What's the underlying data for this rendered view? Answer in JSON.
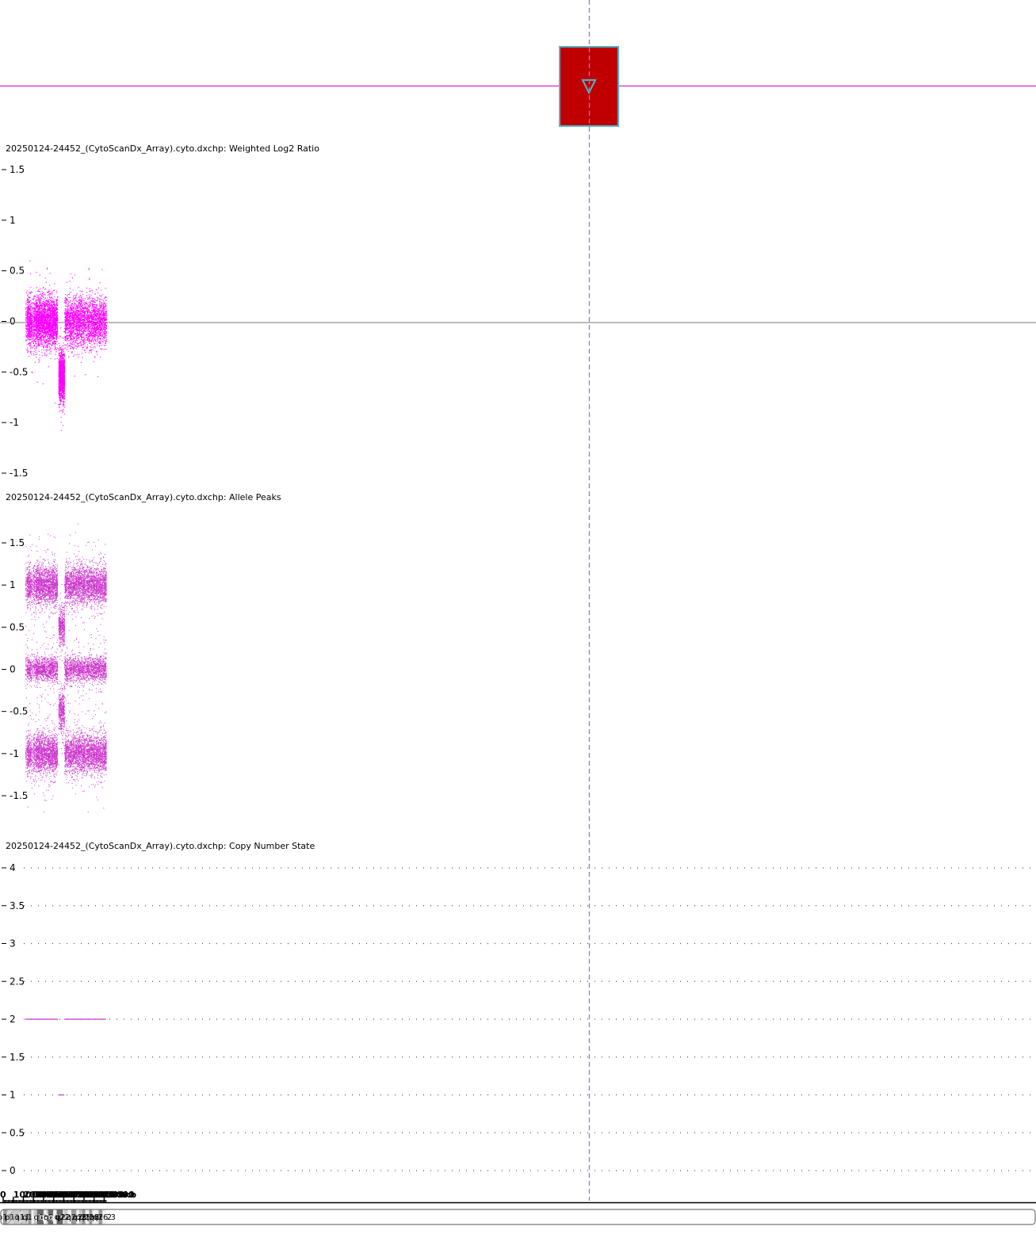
{
  "colors": {
    "signal": "#ff00ff",
    "allele": "#cc33cc",
    "segment_box": "#c00000",
    "segment_border": "#4fb3c8",
    "cursor": "#8080e0"
  },
  "segment_marker": {
    "icon": "triangle-down-icon"
  },
  "tracks": {
    "log2": {
      "title": "20250124-24452_(CytoScanDx_Array).cyto.dxchp: Weighted Log2 Ratio"
    },
    "allele": {
      "title": "20250124-24452_(CytoScanDx_Array).cyto.dxchp: Allele Peaks"
    },
    "cn": {
      "title": "20250124-24452_(CytoScanDx_Array).cyto.dxchp: Copy Number State"
    }
  },
  "chart_data": [
    {
      "type": "scatter",
      "title": "20250124-24452_(CytoScanDx_Array).cyto.dxchp: Weighted Log2 Ratio",
      "ylim": [
        -1.5,
        1.5
      ],
      "yticks": [
        "1.5",
        "1",
        "0.5",
        "0",
        "-0.5",
        "-1",
        "-1.5"
      ],
      "xlim": [
        0,
        102000
      ],
      "segments": [
        {
          "start": 22000,
          "end": 54500,
          "level": 0.0
        },
        {
          "start": 54500,
          "end": 60500,
          "level": -0.55
        },
        {
          "start": 60500,
          "end": 102000,
          "level": 0.0
        }
      ],
      "gaps": [
        [
          22600,
          23300
        ],
        [
          27000,
          27500
        ],
        [
          28600,
          29400
        ],
        [
          30800,
          31300
        ],
        [
          53600,
          54600
        ],
        [
          81000,
          81500
        ]
      ]
    },
    {
      "type": "scatter",
      "title": "20250124-24452_(CytoScanDx_Array).cyto.dxchp: Allele Peaks",
      "ylim": [
        -1.5,
        1.5
      ],
      "yticks": [
        "1.5",
        "1",
        "0.5",
        "0",
        "-0.5",
        "-1",
        "-1.5"
      ],
      "bands_normal": [
        1.0,
        0.0,
        -1.0
      ],
      "bands_deleted_region": [
        0.5,
        -0.5
      ]
    },
    {
      "type": "line",
      "title": "20250124-24452_(CytoScanDx_Array).cyto.dxchp: Copy Number State",
      "ylim": [
        0,
        4
      ],
      "yticks": [
        "4",
        "3.5",
        "3",
        "2.5",
        "2",
        "1.5",
        "1",
        "0.5",
        "0"
      ],
      "segments": [
        {
          "start": 22000,
          "end": 54500,
          "cn": 2
        },
        {
          "start": 54500,
          "end": 60500,
          "cn": 1
        },
        {
          "start": 60500,
          "end": 102000,
          "cn": 2
        }
      ]
    }
  ],
  "xaxis": {
    "ticks": [
      "0",
      "10000kb",
      "20000kb",
      "30000kb",
      "40000kb",
      "50000kb",
      "60000kb",
      "70000kb",
      "80000kb",
      "90000kb",
      "10000"
    ],
    "tick_values": [
      0,
      10000,
      20000,
      30000,
      40000,
      50000,
      60000,
      70000,
      80000,
      90000,
      100000
    ]
  },
  "ideogram": {
    "bands": [
      {
        "label": "p13",
        "start": 0,
        "end": 3800,
        "stain": "gpos50"
      },
      {
        "label": "p12",
        "start": 3800,
        "end": 9800,
        "stain": "stalk"
      },
      {
        "label": "p11.2",
        "start": 9800,
        "end": 15800,
        "stain": "gpos25"
      },
      {
        "label": "p11.1",
        "start": 15800,
        "end": 19200,
        "stain": "stalk"
      },
      {
        "label": "",
        "start": 19200,
        "end": 20500,
        "stain": "gpos25"
      },
      {
        "label": "q11.2",
        "start": 20500,
        "end": 25000,
        "stain": "gpos25"
      },
      {
        "label": "q12",
        "start": 25000,
        "end": 28000,
        "stain": "gpos50"
      },
      {
        "label": "",
        "start": 28000,
        "end": 30200,
        "stain": "gneg"
      },
      {
        "label": "",
        "start": 30200,
        "end": 33500,
        "stain": "gpos25"
      },
      {
        "label": "q14",
        "start": 33500,
        "end": 40000,
        "stain": "gpos75"
      },
      {
        "label": "q15.1",
        "start": 40000,
        "end": 43000,
        "stain": "gneg"
      },
      {
        "label": "",
        "start": 43000,
        "end": 44500,
        "stain": "gpos25"
      },
      {
        "label": "q21.1",
        "start": 44500,
        "end": 49500,
        "stain": "gpos75"
      },
      {
        "label": "q21.2",
        "start": 49500,
        "end": 53000,
        "stain": "gneg"
      },
      {
        "label": "q21.3",
        "start": 53000,
        "end": 59200,
        "stain": "gpos75"
      },
      {
        "label": "",
        "start": 59200,
        "end": 60300,
        "stain": "gneg"
      },
      {
        "label": "q22.2",
        "start": 60300,
        "end": 63800,
        "stain": "gpos25"
      },
      {
        "label": "q22.31",
        "start": 63800,
        "end": 67500,
        "stain": "gneg"
      },
      {
        "label": "q23",
        "start": 67500,
        "end": 72500,
        "stain": "gpos50"
      },
      {
        "label": "",
        "start": 72500,
        "end": 75200,
        "stain": "gneg"
      },
      {
        "label": "",
        "start": 75200,
        "end": 78200,
        "stain": "gpos25"
      },
      {
        "label": "q25.1",
        "start": 78200,
        "end": 81400,
        "stain": "gpos50"
      },
      {
        "label": "q25.2",
        "start": 81400,
        "end": 85100,
        "stain": "gneg"
      },
      {
        "label": "q25.3",
        "start": 85100,
        "end": 88200,
        "stain": "gpos50"
      },
      {
        "label": "q26.1",
        "start": 88200,
        "end": 94500,
        "stain": "gneg"
      },
      {
        "label": "q26.2",
        "start": 94500,
        "end": 98300,
        "stain": "gpos50"
      },
      {
        "label": "q26.3",
        "start": 98300,
        "end": 102000,
        "stain": "gneg"
      }
    ]
  }
}
